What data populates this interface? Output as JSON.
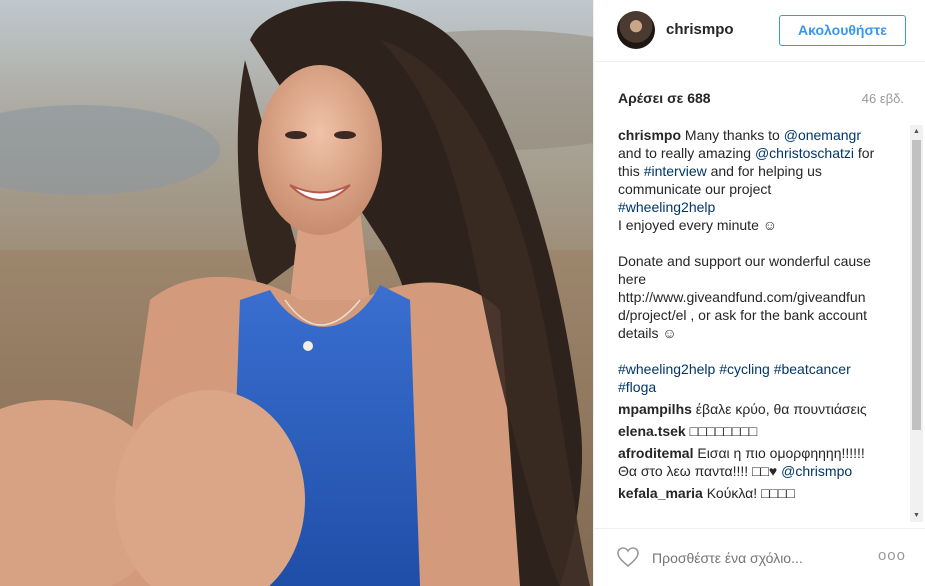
{
  "post": {
    "username": "chrismpo",
    "follow_label": "Ακολουθήστε",
    "likes_label": "Αρέσει σε 688",
    "time_label": "46 εβδ."
  },
  "caption": {
    "user": "chrismpo",
    "line1_text": "Many thanks to ",
    "mention1": "@onemangr",
    "line2_text": "and to really amazing ",
    "mention2": "@christoschatzi",
    "line2b_text": " for",
    "line3_text": "this ",
    "hashtag1": "#interview",
    "line3b_text": " and for helping us",
    "line4_text": "communicate our project",
    "hashtag2": "#wheeling2help",
    "line5_text": "I enjoyed every minute ☺",
    "para2_line1": "Donate and support our wonderful cause",
    "para2_line2": "here",
    "para2_line3": "http://www.giveandfund.com/giveandfun",
    "para2_line4": "d/project/el , or ask for the bank account",
    "para2_line5": "details ☺",
    "tags_line1_a": "#wheeling2help",
    "tags_line1_b": "#cycling",
    "tags_line1_c": "#beatcancer",
    "tags_line2": "#floga"
  },
  "comments": [
    {
      "user": "mpampilhs",
      "text": "έβαλε κρύο, θα πουντιάσεις"
    },
    {
      "user": "elena.tsek",
      "text": "□□□□□□□□"
    },
    {
      "user": "afroditemal",
      "text": "Εισαι η πιο ομορφηηηη!!!!!!",
      "text2": "Θα στο λεω παντα!!!! □□♥ ",
      "mention": "@chrismpo"
    },
    {
      "user": "kefala_maria",
      "text": "Κούκλα! □□□□"
    }
  ],
  "footer": {
    "comment_placeholder": "Προσθέστε ένα σχόλιο...",
    "more_label": "ooo"
  },
  "icons": {
    "heart": "heart-outline-icon",
    "more": "more-options-icon",
    "scroll_up": "scroll-up-arrow-icon",
    "scroll_down": "scroll-down-arrow-icon"
  },
  "colors": {
    "link": "#003569",
    "follow": "#3897f0",
    "muted": "#999999"
  }
}
